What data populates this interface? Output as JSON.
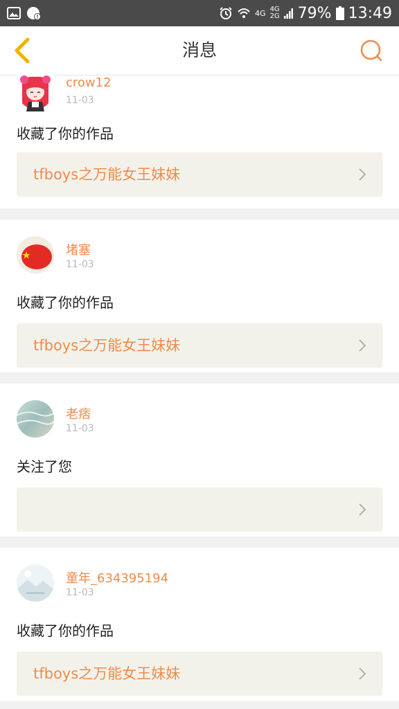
{
  "status": {
    "battery": "79%",
    "time": "13:49",
    "net_top": "4G",
    "net_mid": "4G",
    "net_bot": "2G"
  },
  "header": {
    "title": "消息"
  },
  "colors": {
    "accent": "#f08a4b",
    "back": "#f2b200",
    "card_bg": "#f3f2ea"
  },
  "messages": [
    {
      "username": "crow12",
      "date": "11-03",
      "action": "收藏了你的作品",
      "work": "tfboys之万能女王妹妹",
      "avatar_icon": "anime-girl-avatar"
    },
    {
      "username": "堵塞",
      "date": "11-03",
      "action": "收藏了你的作品",
      "work": "tfboys之万能女王妹妹",
      "avatar_icon": "red-flag-ball-avatar"
    },
    {
      "username": "老痞",
      "date": "11-03",
      "action": "关注了您",
      "work": "",
      "avatar_icon": "ocean-avatar"
    },
    {
      "username": "童年_634395194",
      "date": "11-03",
      "action": "收藏了你的作品",
      "work": "tfboys之万能女王妹妹",
      "avatar_icon": "landscape-avatar"
    }
  ]
}
